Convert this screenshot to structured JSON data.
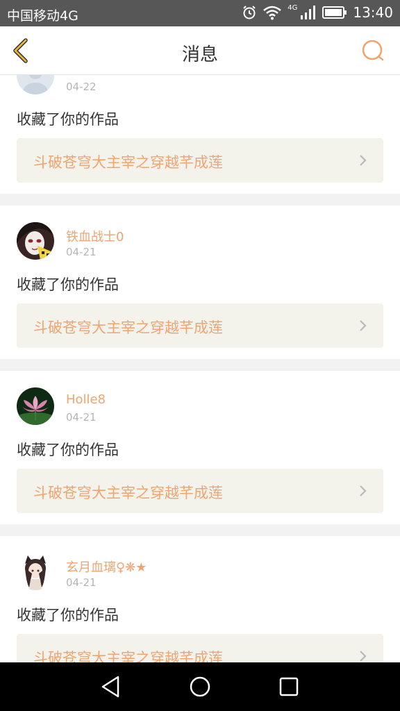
{
  "status_bar": {
    "carrier": "中国移动4G",
    "network": "4G",
    "time": "13:40"
  },
  "header": {
    "title": "消息"
  },
  "messages": [
    {
      "user": "",
      "date": "04-22",
      "action": "收藏了你的作品",
      "work_title": "斗破苍穹大主宰之穿越芊成莲"
    },
    {
      "user": "铁血战士0",
      "date": "04-21",
      "action": "收藏了你的作品",
      "work_title": "斗破苍穹大主宰之穿越芊成莲"
    },
    {
      "user": "Holle8",
      "date": "04-21",
      "action": "收藏了你的作品",
      "work_title": "斗破苍穹大主宰之穿越芊成莲"
    },
    {
      "user": "玄月血璃♀❋★",
      "date": "04-21",
      "action": "收藏了你的作品",
      "work_title": "斗破苍穹大主宰之穿越芊成莲"
    }
  ],
  "colors": {
    "accent": "#f0a470",
    "header_bg": "#ffffff",
    "status_bg": "#575757",
    "work_bg": "#f3f3ec"
  }
}
